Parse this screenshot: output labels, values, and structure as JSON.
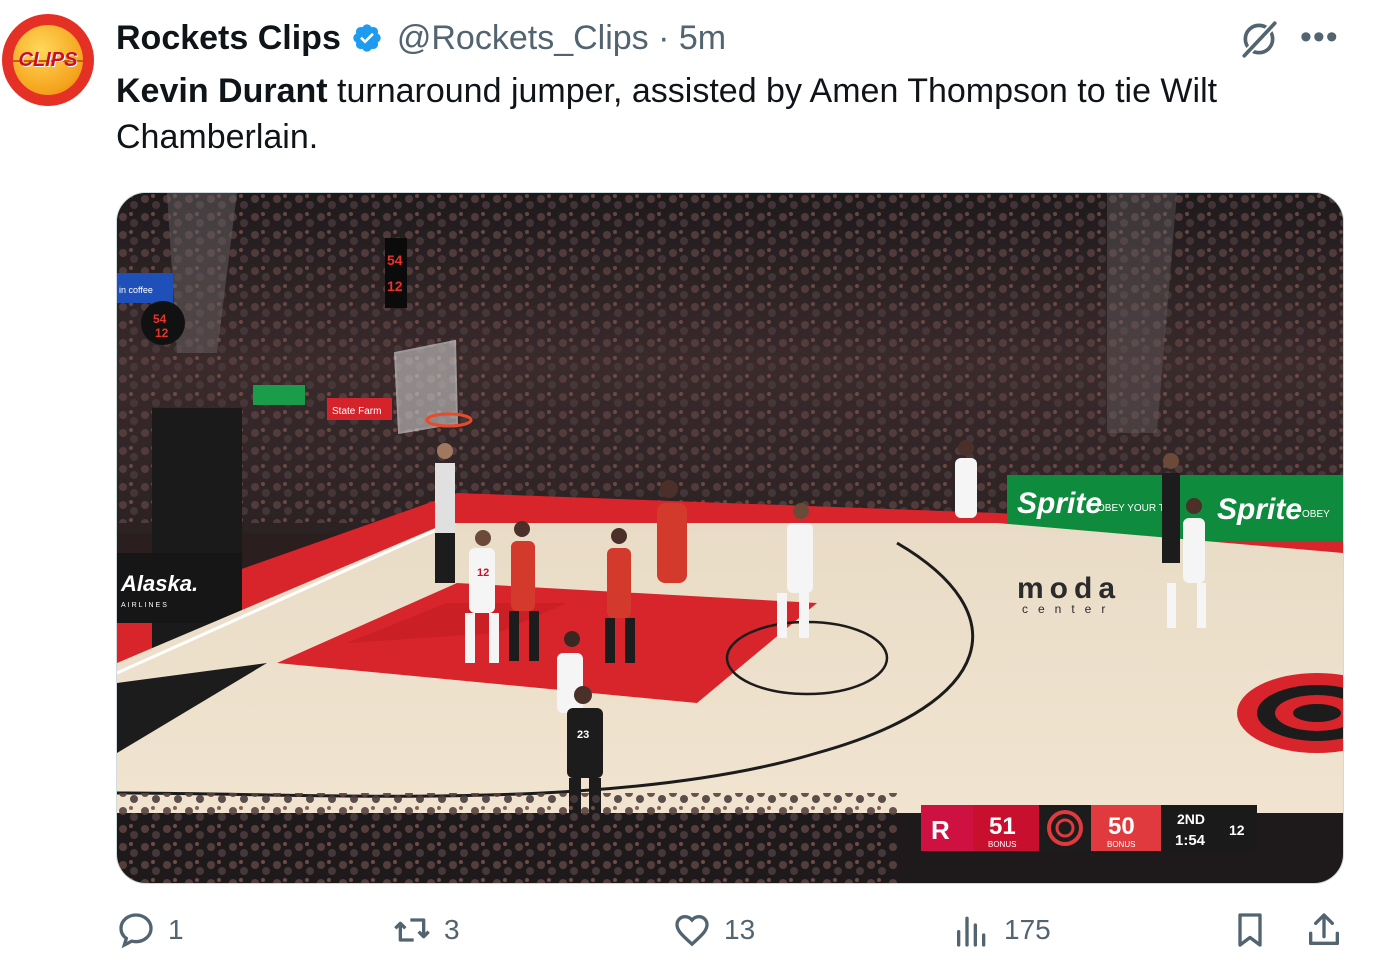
{
  "tweet": {
    "avatar_text": "CLIPS",
    "author_name": "Rockets Clips",
    "author_handle": "@Rockets_Clips · 5m",
    "text_bold": "Kevin Durant",
    "text_rest": " turnaround jumper, assisted by Amen Thompson to tie Wilt Chamberlain."
  },
  "video": {
    "home_score": "51",
    "home_bonus": "BONUS",
    "away_score": "50",
    "away_bonus": "BONUS",
    "period": "2ND",
    "clock": "1:54",
    "shot_clock": "12",
    "sponsor_sprite": "Sprite",
    "sponsor_sprite_tag": "OBEY YOUR TH",
    "sponsor_sprite2": "Sprite",
    "sponsor_sprite2_tag": "OBEY",
    "sponsor_alaska": "Alaska.",
    "sponsor_alaska_sub": "AIRLINES",
    "sponsor_statefarm": "State Farm",
    "courtname": "moda",
    "courtname_sub": "center",
    "coffee": "in coffee",
    "referee_number": "23",
    "player_number_home": "12",
    "shotclock_display_1": "54",
    "shotclock_display_2": "12"
  },
  "actions": {
    "reply_count": "1",
    "retweet_count": "3",
    "like_count": "13",
    "views_count": "175"
  },
  "colors": {
    "accent": "#1d9bf0",
    "muted": "#536471",
    "blazers_red": "#e03a3e"
  }
}
